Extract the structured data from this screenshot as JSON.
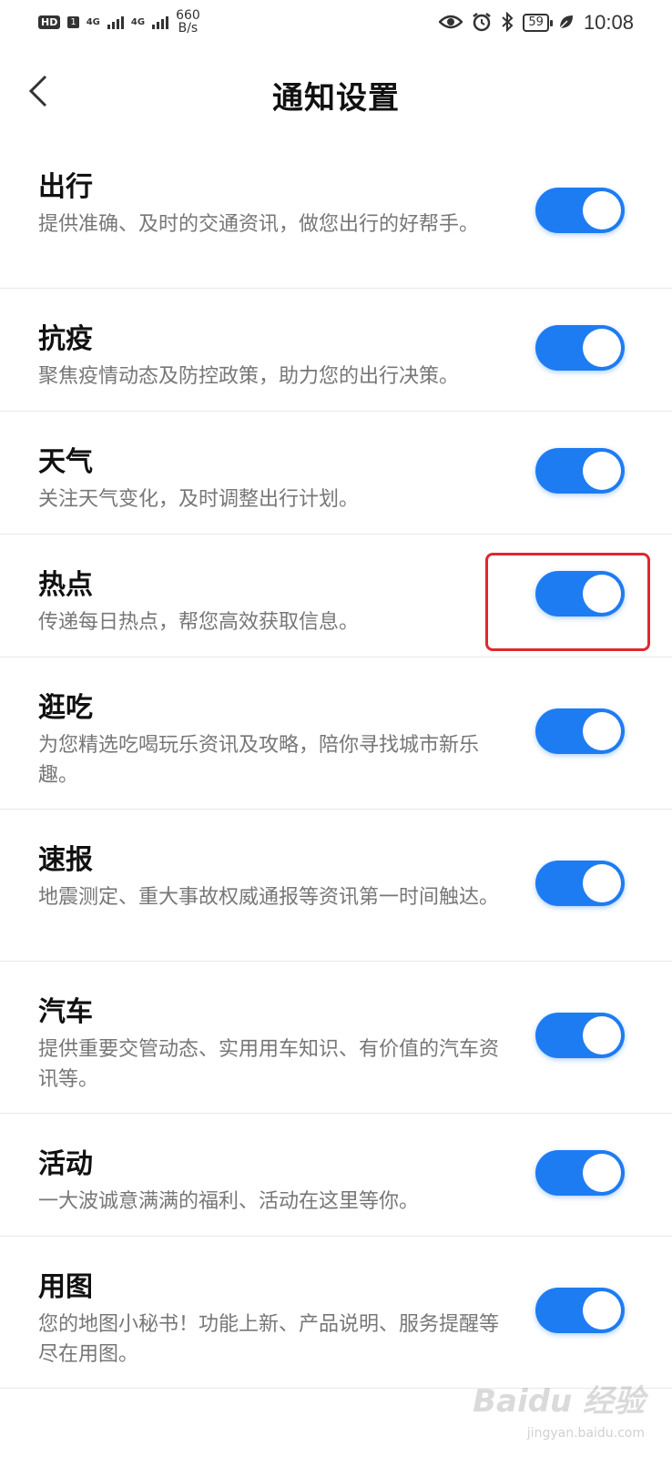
{
  "status_bar": {
    "hd": "HD",
    "sim": "1",
    "net1": "4G",
    "net2": "4G",
    "speed_value": "660",
    "speed_unit": "B/s",
    "battery": "59",
    "time": "10:08"
  },
  "header": {
    "title": "通知设置"
  },
  "items": [
    {
      "title": "出行",
      "desc": "提供准确、及时的交通资讯，做您出行的好帮手。",
      "on": true
    },
    {
      "title": "抗疫",
      "desc": "聚焦疫情动态及防控政策，助力您的出行决策。",
      "on": true
    },
    {
      "title": "天气",
      "desc": "关注天气变化，及时调整出行计划。",
      "on": true
    },
    {
      "title": "热点",
      "desc": "传递每日热点，帮您高效获取信息。",
      "on": true
    },
    {
      "title": "逛吃",
      "desc": "为您精选吃喝玩乐资讯及攻略，陪你寻找城市新乐趣。",
      "on": true
    },
    {
      "title": "速报",
      "desc": "地震测定、重大事故权威通报等资讯第一时间触达。",
      "on": true
    },
    {
      "title": "汽车",
      "desc": "提供重要交管动态、实用用车知识、有价值的汽车资讯等。",
      "on": true
    },
    {
      "title": "活动",
      "desc": "一大波诚意满满的福利、活动在这里等你。",
      "on": true
    },
    {
      "title": "用图",
      "desc": "您的地图小秘书！功能上新、产品说明、服务提醒等尽在用图。",
      "on": true
    }
  ],
  "watermark": {
    "brand": "Baidu 经验",
    "url": "jingyan.baidu.com"
  },
  "colors": {
    "toggle_on": "#1e7cf2",
    "highlight": "#e0282e"
  }
}
